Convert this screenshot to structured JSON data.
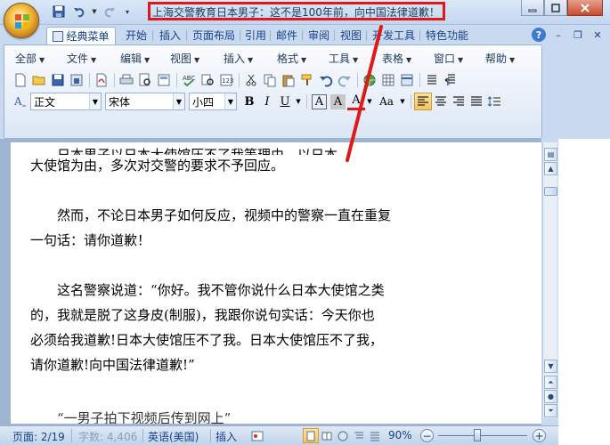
{
  "window": {
    "title": "上海交警教育日本男子：这不是100年前，向中国法律道歉！_"
  },
  "tabs": [
    {
      "label": "经典菜单",
      "active": true
    },
    {
      "label": "开始"
    },
    {
      "label": "插入"
    },
    {
      "label": "页面布局"
    },
    {
      "label": "引用"
    },
    {
      "label": "邮件"
    },
    {
      "label": "审阅"
    },
    {
      "label": "视图"
    },
    {
      "label": "开发工具"
    },
    {
      "label": "特色功能"
    }
  ],
  "menu": [
    "全部",
    "文件",
    "编辑",
    "视图",
    "插入",
    "格式",
    "工具",
    "表格",
    "窗口",
    "帮助"
  ],
  "format": {
    "style": "正文",
    "font": "宋体",
    "size": "小四",
    "bold": "B",
    "italic": "I",
    "underline": "U",
    "char_border": "A",
    "char_shade": "A",
    "font_color": "A",
    "change_case": "Aa"
  },
  "document": {
    "top_partial": "大使馆为由，多次对交警的要求不予回应。",
    "paragraphs": [
      [
        "　　然而，不论日本男子如何反应，视频中的警察一直在重复",
        "一句话：请你道歉！"
      ],
      [
        "　　这名警察说道：“你好。我不管你说什么日本大使馆之类",
        "的，我就是脱了这身皮(制服)，我跟你说句实话：今天你也",
        "必须给我道歉!日本大使馆压不了我。日本大使馆压不了我，",
        "请你道歉!向中国法律道歉!”"
      ]
    ]
  },
  "status": {
    "page": "页面: 2/19",
    "words": "字数: 4,406",
    "language": "英语(美国)",
    "mode": "插入",
    "zoom": "90%",
    "zoom_level_percent": 90,
    "zoom_minus": "−",
    "zoom_plus": "+"
  },
  "colors": {
    "annotation": "#e01818",
    "ribbon_text": "#15428b"
  }
}
